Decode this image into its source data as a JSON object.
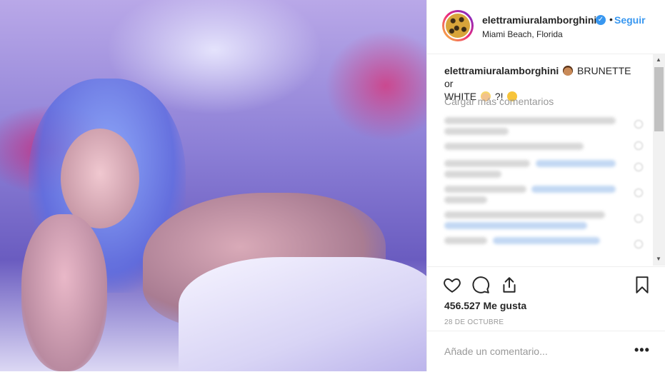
{
  "post": {
    "username": "elettramiuralamborghini",
    "verified_icon": "verified-badge-icon",
    "separator": "•",
    "follow_label": "Seguir",
    "location": "Miami Beach, Florida",
    "avatar_icon": "leopard-print-avatar"
  },
  "caption": {
    "username": "elettramiuralamborghini",
    "text_part1": "BRUNETTE or",
    "text_part2": "WHITE",
    "text_part3": "?!",
    "emojis": [
      "woman-brunette-emoji",
      "woman-blonde-emoji",
      "thinking-face-emoji"
    ]
  },
  "comments": {
    "load_more_label": "Cargar más comentarios"
  },
  "actions": {
    "icons": [
      "heart-icon",
      "comment-icon",
      "share-icon",
      "bookmark-icon"
    ],
    "likes": "456.527 Me gusta",
    "date": "28 DE OCTUBRE"
  },
  "add_comment": {
    "placeholder": "Añade un comentario...",
    "more_label": "•••"
  },
  "colors": {
    "accent": "#3897f0",
    "text": "#262626",
    "muted": "#999999",
    "border": "#efefef"
  }
}
